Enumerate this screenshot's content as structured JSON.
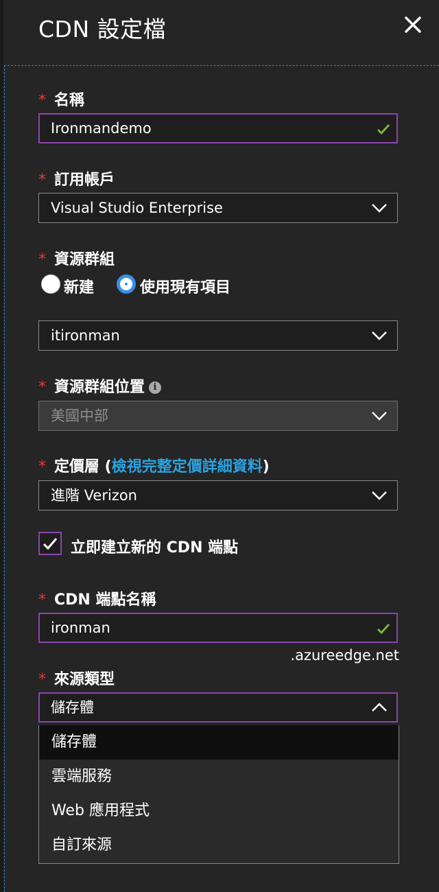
{
  "header": {
    "title": "CDN 設定檔",
    "close_icon": "close-icon"
  },
  "required_marker": "*",
  "name_field": {
    "label": "名稱",
    "value": "Ironmandemo",
    "valid_icon": "checkmark-icon"
  },
  "subscription": {
    "label": "訂用帳戶",
    "value": "Visual Studio Enterprise"
  },
  "resource_group": {
    "label": "資源群組",
    "options": [
      {
        "label": "新建",
        "selected": false
      },
      {
        "label": "使用現有項目",
        "selected": true
      }
    ],
    "value": "itironman"
  },
  "resource_group_location": {
    "label": "資源群組位置",
    "info_icon": "info-icon",
    "info_glyph": "i",
    "value": "美國中部",
    "disabled": true
  },
  "pricing_tier": {
    "label_before": "定價層 (",
    "link": "檢視完整定價詳細資料",
    "label_after": ")",
    "value": "進階 Verizon"
  },
  "create_endpoint": {
    "label": "立即建立新的 CDN 端點",
    "checked": true
  },
  "endpoint_name": {
    "label": "CDN 端點名稱",
    "value": "ironman",
    "suffix": ".azureedge.net",
    "valid_icon": "checkmark-icon"
  },
  "origin_type": {
    "label": "來源類型",
    "value": "儲存體",
    "expanded": true,
    "options": [
      "儲存體",
      "雲端服務",
      "Web 應用程式",
      "自訂來源"
    ],
    "selected_index": 0
  },
  "colors": {
    "background": "#252526",
    "accent": "#8e44ad",
    "required": "#e53935",
    "link": "#2aa2e0",
    "valid": "#7cb342",
    "radio": "#3a8fe6"
  }
}
